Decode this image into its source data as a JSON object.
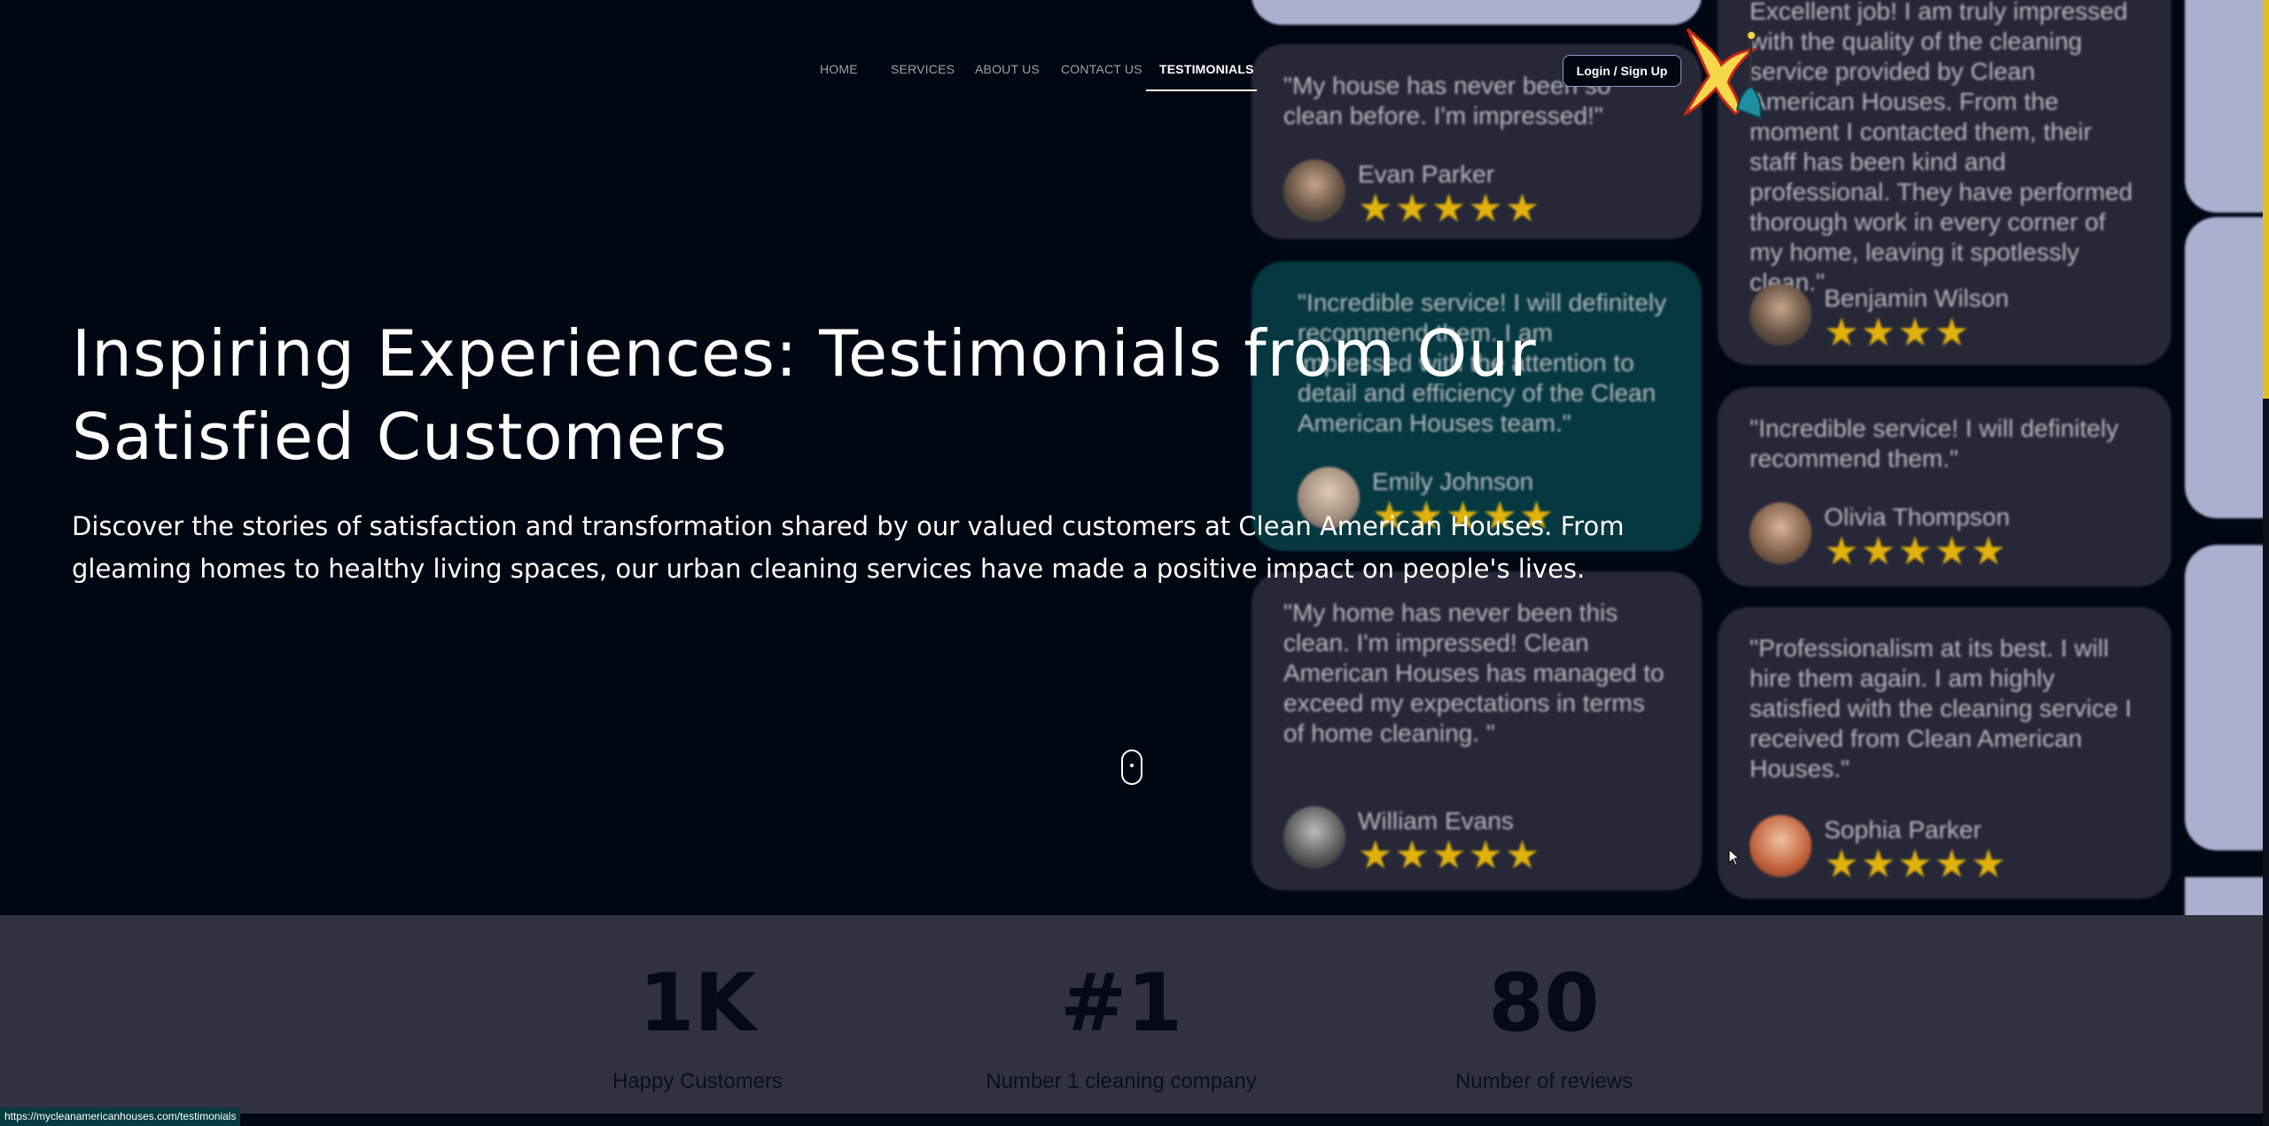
{
  "nav": {
    "items": [
      "HOME",
      "SERVICES",
      "ABOUT US",
      "CONTACT US",
      "TESTIMONIALS"
    ],
    "active": "TESTIMONIALS",
    "login_label": "Login / Sign Up"
  },
  "hero": {
    "title": "Inspiring Experiences: Testimonials from Our Satisfied Customers",
    "subtitle": "Discover the stories of satisfaction and transformation shared by our valued customers at Clean American Houses. From gleaming homes to healthy living spaces, our urban cleaning services have made a positive impact on people's lives."
  },
  "testimonials": [
    {
      "quote": "\"My house has never been so clean before. I'm impressed!\"",
      "name": "Evan Parker",
      "stars": 5
    },
    {
      "quote": "\"Incredible service! I will definitely recommend them. I am impressed with the attention to detail and efficiency of the Clean American Houses team.\"",
      "name": "Emily Johnson",
      "stars": 5
    },
    {
      "quote": "\"My home has never been this clean. I'm impressed! Clean American Houses has managed to exceed my expectations in terms of home cleaning. \"",
      "name": "William Evans",
      "stars": 5
    },
    {
      "quote": "Excellent job! I am truly impressed with the quality of the cleaning service provided by Clean American Houses. From the moment I contacted them, their staff has been kind and professional. They have performed thorough work in every corner of my home, leaving it spotlessly clean.\"",
      "name": "Benjamin Wilson",
      "stars": 4
    },
    {
      "quote": "\"Incredible service! I will definitely recommend them.\"",
      "name": "Olivia Thompson",
      "stars": 5
    },
    {
      "quote": "\"Professionalism at its best. I will hire them again. I am highly satisfied with the cleaning service I received from Clean American Houses.\"",
      "name": "Sophia Parker",
      "stars": 5
    }
  ],
  "stats": [
    {
      "value": "1K",
      "label": "Happy Customers"
    },
    {
      "value": "#1",
      "label": "Number 1 cleaning company"
    },
    {
      "value": "80",
      "label": "Number of reviews"
    }
  ],
  "status_url": "https://mycleanamericanhouses.com/testimonials",
  "colors": {
    "background": "#010613",
    "card": "#262838",
    "card_highlight": "#053840",
    "star": "#e1b10c",
    "stats_band": "#30323f",
    "lavender": "#acb0d0"
  }
}
